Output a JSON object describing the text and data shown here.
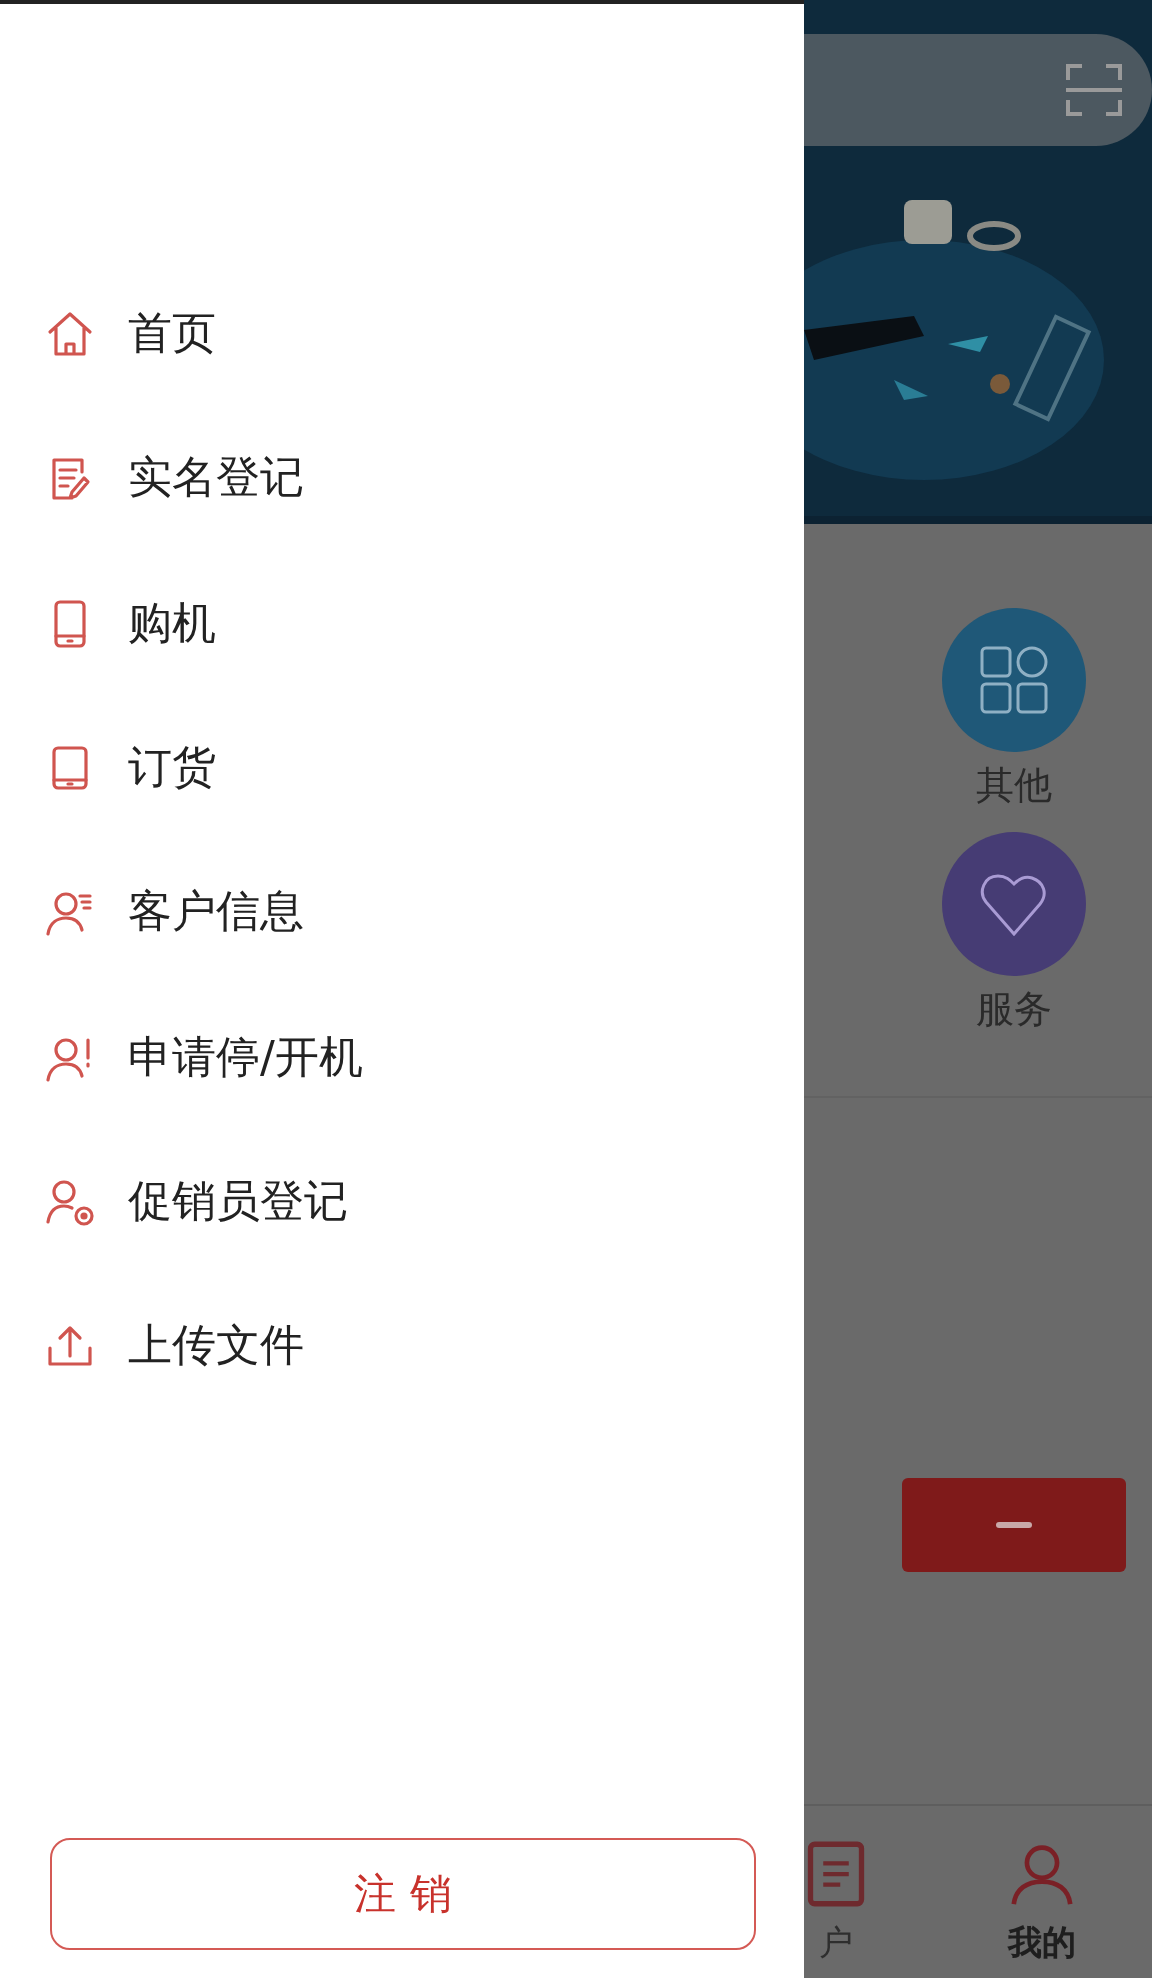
{
  "drawer": {
    "menu": [
      {
        "label": "首页",
        "kind": "home"
      },
      {
        "label": "实名登记",
        "kind": "form"
      },
      {
        "label": "购机",
        "kind": "phone"
      },
      {
        "label": "订货",
        "kind": "tablet"
      },
      {
        "label": "客户信息",
        "kind": "userlist"
      },
      {
        "label": "申请停/开机",
        "kind": "useralert"
      },
      {
        "label": "促销员登记",
        "kind": "userbadge"
      },
      {
        "label": "上传文件",
        "kind": "upload"
      }
    ],
    "logout_button": "注 销"
  },
  "background": {
    "tiles": [
      {
        "label": "其他",
        "color": "#1f5878",
        "kind": "grid"
      },
      {
        "label": "服务",
        "color": "#463c74",
        "kind": "heart"
      }
    ],
    "tab_bar": [
      {
        "label": "户",
        "kind": "doc",
        "selected": false
      },
      {
        "label": "我的",
        "kind": "person",
        "selected": true
      }
    ]
  }
}
